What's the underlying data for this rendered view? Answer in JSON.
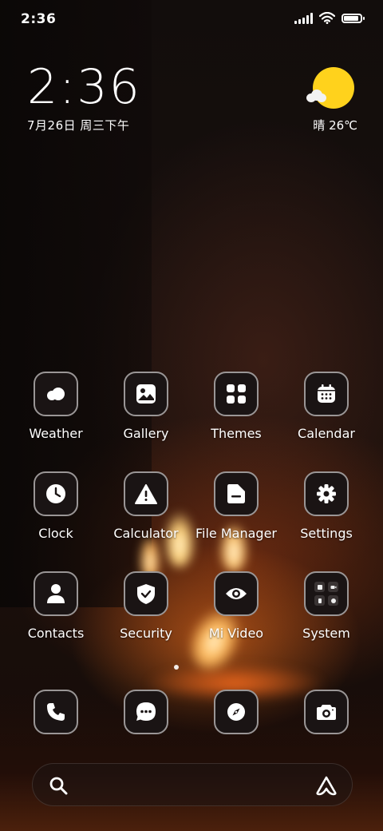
{
  "status_bar": {
    "time": "2:36",
    "signal_bars": 5,
    "wifi": "wifi-icon",
    "battery_level": 0.9
  },
  "clock_widget": {
    "time": "2:36",
    "date": "7月26日 周三下午"
  },
  "weather_widget": {
    "icon": "sun-with-cloud-icon",
    "text": "晴 26℃"
  },
  "apps": [
    {
      "label": "Weather",
      "icon": "weather-icon"
    },
    {
      "label": "Gallery",
      "icon": "gallery-icon"
    },
    {
      "label": "Themes",
      "icon": "themes-icon"
    },
    {
      "label": "Calendar",
      "icon": "calendar-icon"
    },
    {
      "label": "Clock",
      "icon": "clock-icon"
    },
    {
      "label": "Calculator",
      "icon": "calculator-icon"
    },
    {
      "label": "File Manager",
      "icon": "file-manager-icon"
    },
    {
      "label": "Settings",
      "icon": "settings-icon"
    },
    {
      "label": "Contacts",
      "icon": "contacts-icon"
    },
    {
      "label": "Security",
      "icon": "security-icon"
    },
    {
      "label": "Mi Video",
      "icon": "mi-video-icon"
    },
    {
      "label": "System",
      "icon": "system-folder-icon"
    }
  ],
  "dock": [
    {
      "icon": "phone-icon"
    },
    {
      "icon": "messages-icon"
    },
    {
      "icon": "browser-icon"
    },
    {
      "icon": "camera-icon"
    }
  ],
  "page_indicator": {
    "pages": 1,
    "current": 1
  },
  "search_bar": {
    "left_icon": "search-icon",
    "right_icon": "assistant-icon"
  },
  "colors": {
    "icon_border": "#9a9696",
    "icon_bg": "#1a1414",
    "sun": "#ffd21c",
    "flame": "#ffb860"
  }
}
